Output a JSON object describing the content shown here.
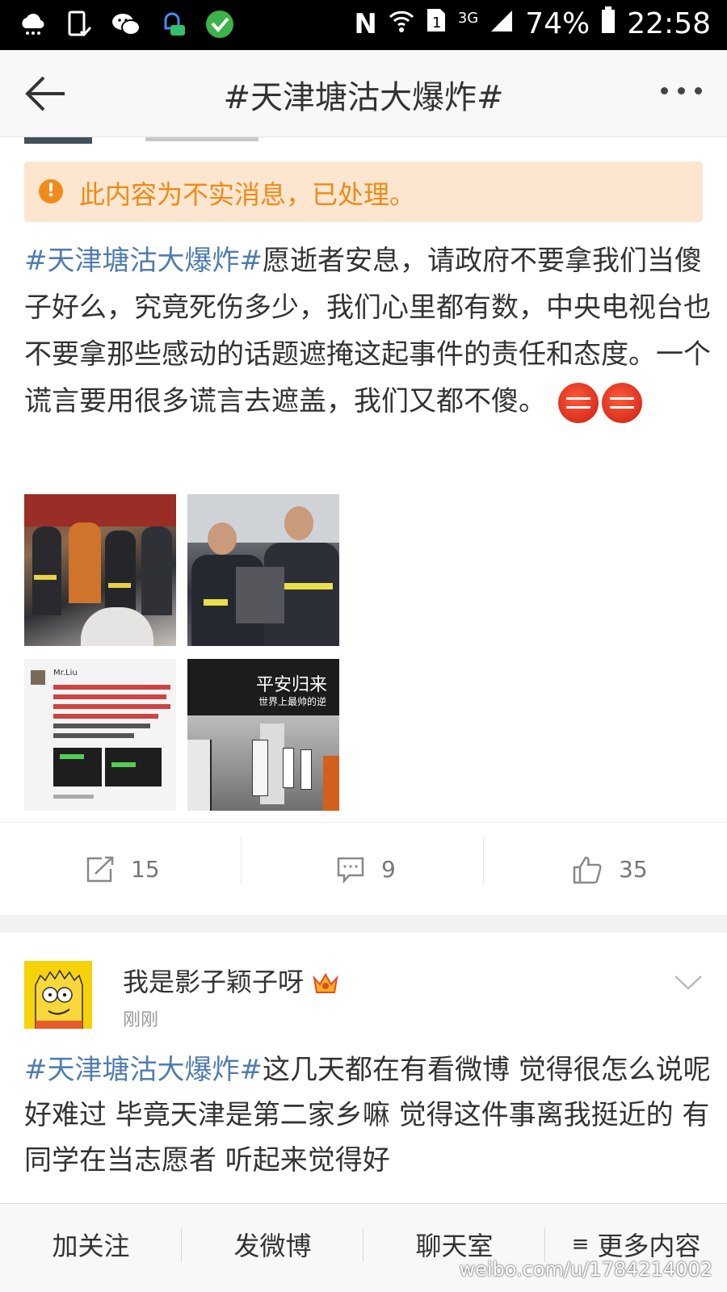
{
  "status_bar": {
    "battery": "74%",
    "time": "22:58",
    "network": "3G"
  },
  "nav": {
    "title": "#天津塘沽大爆炸#"
  },
  "post1": {
    "notice": "此内容为不实消息，已处理。",
    "hashtag": "#天津塘沽大爆炸#",
    "text": "愿逝者安息，请政府不要拿我们当傻子好么，究竟死伤多少，我们心里都有数，中央电视台也不要拿那些感动的话题遮掩这起事件的责任和态度。一个谎言要用很多谎言去遮盖，我们又都不傻。",
    "photo3_caption": "Mr.Liu",
    "photo4_caption": "平安归来",
    "photo4_subcaption": "世界上最帅的逆",
    "reposts": "15",
    "comments": "9",
    "likes": "35"
  },
  "post2": {
    "username": "我是影子颖子呀",
    "time": "刚刚",
    "hashtag": "#天津塘沽大爆炸#",
    "text": "这几天都在有看微博 觉得很怎么说呢 好难过 毕竟天津是第二家乡嘛 觉得这件事离我挺近的 有同学在当志愿者 听起来觉得好"
  },
  "bottom_bar": {
    "follow": "加关注",
    "post": "发微博",
    "chat": "聊天室",
    "more": "更多内容"
  },
  "watermark": "weibo.com/u/1784214002",
  "colors": {
    "hashtag": "#507daf",
    "notice_bg": "#fde6cf",
    "notice_text": "#ee8a18"
  }
}
